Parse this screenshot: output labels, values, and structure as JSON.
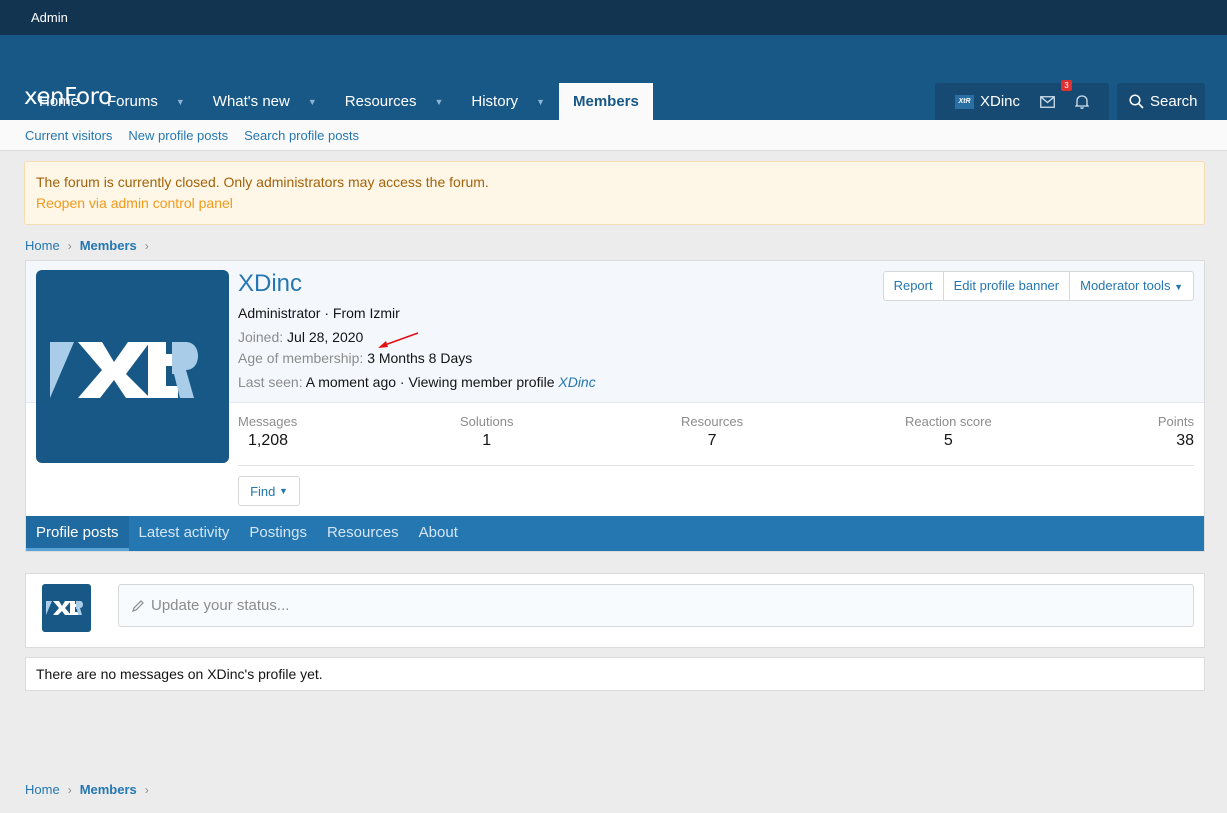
{
  "topbar": {
    "label": "Admin"
  },
  "logo": "xenForo",
  "nav": [
    {
      "label": "Home",
      "dropdown": false
    },
    {
      "label": "Forums",
      "dropdown": true
    },
    {
      "label": "What's new",
      "dropdown": true
    },
    {
      "label": "Resources",
      "dropdown": true
    },
    {
      "label": "History",
      "dropdown": true
    },
    {
      "label": "Members",
      "dropdown": false,
      "active": true
    }
  ],
  "user_menu": {
    "username": "XDinc",
    "alert_count": "3",
    "search_label": "Search"
  },
  "subnav": [
    "Current visitors",
    "New profile posts",
    "Search profile posts"
  ],
  "notice": {
    "line1": "The forum is currently closed. Only administrators may access the forum.",
    "line2": "Reopen via admin control panel"
  },
  "breadcrumb": {
    "home": "Home",
    "current": "Members"
  },
  "profile": {
    "name": "XDinc",
    "title": "Administrator · From Izmir",
    "joined_label": "Joined:",
    "joined_value": "Jul 28, 2020",
    "age_label": "Age of membership:",
    "age_value": "3 Months 8 Days",
    "last_seen_label": "Last seen:",
    "last_seen_value": "A moment ago · Viewing member profile",
    "last_seen_link": "XDinc",
    "buttons": {
      "report": "Report",
      "edit_banner": "Edit profile banner",
      "mod_tools": "Moderator tools"
    },
    "stats": [
      {
        "label": "Messages",
        "value": "1,208"
      },
      {
        "label": "Solutions",
        "value": "1"
      },
      {
        "label": "Resources",
        "value": "7"
      },
      {
        "label": "Reaction score",
        "value": "5"
      },
      {
        "label": "Points",
        "value": "38"
      }
    ],
    "find_label": "Find",
    "tabs": [
      "Profile posts",
      "Latest activity",
      "Postings",
      "Resources",
      "About"
    ]
  },
  "status": {
    "placeholder": "Update your status..."
  },
  "no_messages": "There are no messages on XDinc's profile yet.",
  "colors": {
    "header": "#185886",
    "topbar": "#133451",
    "accent": "#2577b1",
    "notice_bg": "#fef6e6"
  },
  "icons": [
    "chevron-down-icon",
    "mail-icon",
    "bell-icon",
    "search-icon",
    "pencil-icon",
    "chevron-right-icon",
    "arrow-annotation"
  ]
}
